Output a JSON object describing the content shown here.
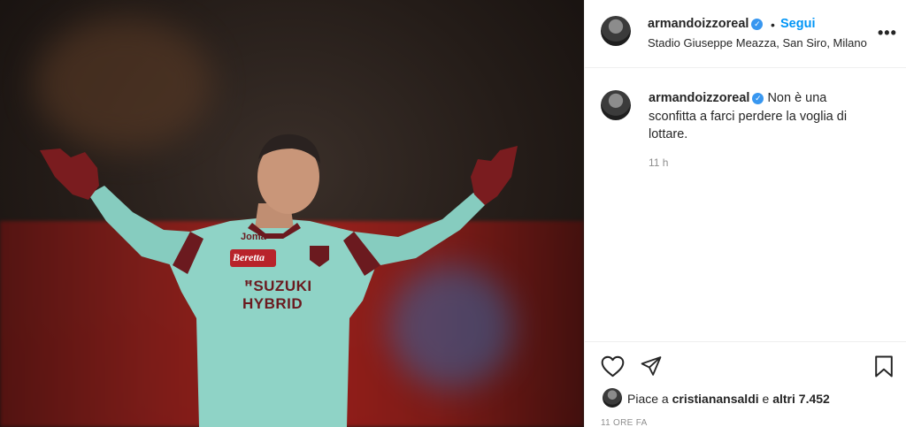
{
  "post": {
    "author": {
      "username": "armandoizzoreal",
      "verified_icon": "verified-badge-icon",
      "follow_label": "Segui",
      "separator": "•"
    },
    "location": "Stadio Giuseppe Meazza, San Siro, Milano",
    "more_icon": "more-options-icon",
    "more_label": "•••",
    "caption": {
      "username": "armandoizzoreal",
      "text": "Non è una sconfitta a farci perdere la voglia di lottare.",
      "time": "11 h"
    },
    "photo": {
      "jersey_brand": "Joma",
      "sponsor_top": "Beretta",
      "sponsor_main_1": "SUZUKI",
      "sponsor_main_2": "HYBRID"
    },
    "actions": {
      "like_icon": "heart-icon",
      "share_icon": "send-icon",
      "save_icon": "bookmark-icon"
    },
    "likes": {
      "prefix": "Piace a",
      "user": "cristianansaldi",
      "connector": "e",
      "others": "altri 7.452"
    },
    "timestamp": "11 ORE FA",
    "colors": {
      "link": "#0095f6",
      "verified": "#3897f0",
      "text": "#262626",
      "muted": "#8e8e8e",
      "jersey": "#8fd3c6",
      "jersey_accent": "#6b1a1f"
    }
  }
}
